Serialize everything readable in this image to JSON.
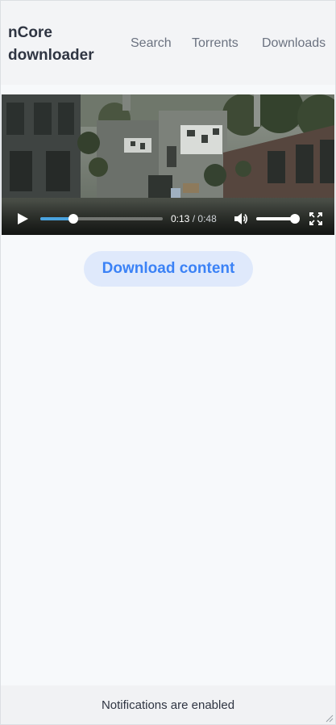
{
  "header": {
    "brand": "nCore downloader",
    "nav": {
      "search": "Search",
      "torrents": "Torrents",
      "downloads": "Downloads"
    }
  },
  "video": {
    "current_time": "0:13",
    "separator": "/",
    "duration": "0:48",
    "progress_fraction": 0.27,
    "volume_fraction": 1.0,
    "icons": {
      "play": "play-icon",
      "volume": "volume-icon",
      "fullscreen": "fullscreen-icon"
    }
  },
  "main": {
    "download_label": "Download content"
  },
  "footer": {
    "status": "Notifications are enabled"
  },
  "colors": {
    "accent": "#3b82f6",
    "button_bg": "#dfe9fb",
    "progress": "#4aa3df",
    "page_bg": "#f7f9fb"
  }
}
